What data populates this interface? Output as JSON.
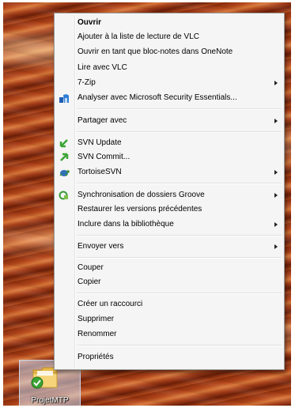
{
  "context_menu": {
    "items": [
      {
        "label": "Ouvrir",
        "bold": true
      },
      {
        "label": "Ajouter à la liste de lecture de VLC"
      },
      {
        "label": "Ouvrir en tant que bloc-notes dans OneNote"
      },
      {
        "label": "Lire avec VLC"
      },
      {
        "label": "7-Zip",
        "submenu": true
      },
      {
        "label": "Analyser avec Microsoft Security Essentials...",
        "icon": "security-essentials-icon"
      },
      {
        "label": "Partager avec",
        "submenu": true
      },
      {
        "label": "SVN Update",
        "icon": "svn-update-icon"
      },
      {
        "label": "SVN Commit...",
        "icon": "svn-commit-icon"
      },
      {
        "label": "TortoiseSVN",
        "icon": "tortoisesvn-icon",
        "submenu": true
      },
      {
        "label": "Synchronisation de dossiers Groove",
        "icon": "groove-sync-icon",
        "submenu": true
      },
      {
        "label": "Restaurer les versions précédentes"
      },
      {
        "label": "Inclure dans la bibliothèque",
        "submenu": true
      },
      {
        "label": "Envoyer vers",
        "submenu": true
      },
      {
        "label": "Couper"
      },
      {
        "label": "Copier"
      },
      {
        "label": "Créer un raccourci"
      },
      {
        "label": "Supprimer"
      },
      {
        "label": "Renommer"
      },
      {
        "label": "Propriétés"
      }
    ]
  },
  "desktop_icon": {
    "label": "ProjetMTP",
    "icon": "folder-icon",
    "overlay": "svn-normal-checkmark-icon"
  },
  "colors": {
    "menu_background": "#f5f5f5",
    "menu_border": "#979797",
    "svn_green": "#3aa435"
  }
}
